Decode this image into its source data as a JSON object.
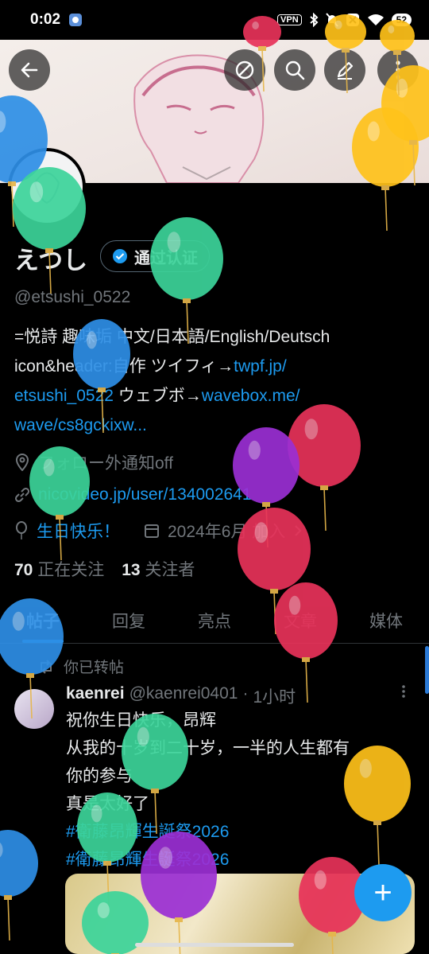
{
  "status_bar": {
    "time": "0:02",
    "vpn": "VPN",
    "battery": "52"
  },
  "profile": {
    "display_name": "えつし",
    "verify_label": "通过认证",
    "handle": "@etsushi_0522",
    "bio": {
      "line1": "=悦詩 趣味垢 中文/日本語/English/Deutsch",
      "line2_prefix": "icon&header:自作  ツイフィ→",
      "line2_link": "twpf.jp/",
      "line3_link": "etsushi_0522",
      "line3_mid": " ウェブボ→",
      "line3_link2": "wavebox.me/",
      "line4_link": "wave/cs8gckixw..."
    },
    "location": "フォロー外通知off",
    "website": "nicovideo.jp/user/134002641",
    "birthday": "生日快乐！",
    "joined": "2024年6月 加入",
    "following_count": "70",
    "following_label": "正在关注",
    "followers_count": "13",
    "followers_label": "关注者"
  },
  "tabs": [
    "帖子",
    "回复",
    "亮点",
    "文章",
    "媒体"
  ],
  "post": {
    "retweet_label": "你已转帖",
    "author_name": "kaenrei",
    "author_handle": "@kaenrei0401",
    "separator": "·",
    "time": "1小时",
    "lines": [
      "祝你生日快乐，昂辉",
      "从我的十岁到二十岁，一半的人生都有",
      "你的参与",
      "真是太好了"
    ],
    "hashtags": [
      "#衛藤昂輝生誕祭2026",
      "#衛藤昂輝生誕祭2026"
    ]
  },
  "fab_label": "+",
  "colors": {
    "accent": "#1d9bf0",
    "background": "#000000",
    "text_primary": "#e7e9ea",
    "text_secondary": "#71767b"
  },
  "icons": [
    "back-arrow-icon",
    "block-icon",
    "search-icon",
    "edit-icon",
    "more-vertical-icon",
    "verified-badge-icon",
    "location-icon",
    "link-icon",
    "balloon-icon",
    "calendar-icon",
    "chevron-right-icon",
    "retweet-icon",
    "plus-icon"
  ]
}
